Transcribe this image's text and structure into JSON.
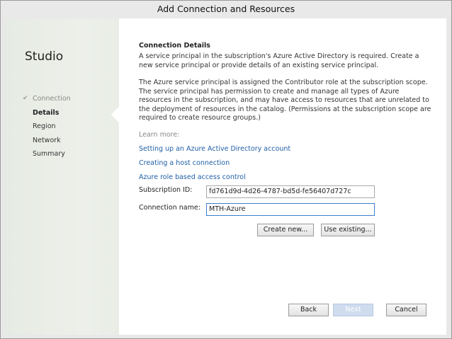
{
  "window": {
    "title": "Add Connection and Resources"
  },
  "sidebar": {
    "app_name": "Studio",
    "steps": [
      {
        "label": "Connection",
        "state": "done",
        "icon": "check-icon"
      },
      {
        "label": "Details",
        "state": "current"
      },
      {
        "label": "Region",
        "state": "pending"
      },
      {
        "label": "Network",
        "state": "pending"
      },
      {
        "label": "Summary",
        "state": "pending"
      }
    ]
  },
  "main": {
    "heading": "Connection Details",
    "para1": "A service principal in the subscription's Azure Active Directory is required. Create a new service principal or provide details of an existing service principal.",
    "para2": "The Azure service principal is assigned the Contributor role at the subscription scope. The service principal has permission to create and manage all types of Azure resources in the subscription, and may have access to resources that are unrelated to the deployment of resources in the catalog. (Permissions at the subscription scope are required to create resource groups.)",
    "learn_more": "Learn more:",
    "links": [
      "Setting up an Azure Active Directory account",
      "Creating a host connection",
      "Azure role based access control"
    ],
    "subscription_label": "Subscription ID:",
    "subscription_value": "fd761d9d-4d26-4787-bd5d-fe56407d727c",
    "connection_label": "Connection name:",
    "connection_value": "MTH-Azure",
    "create_new": "Create new...",
    "use_existing": "Use existing..."
  },
  "footer": {
    "back": "Back",
    "next": "Next",
    "cancel": "Cancel"
  }
}
